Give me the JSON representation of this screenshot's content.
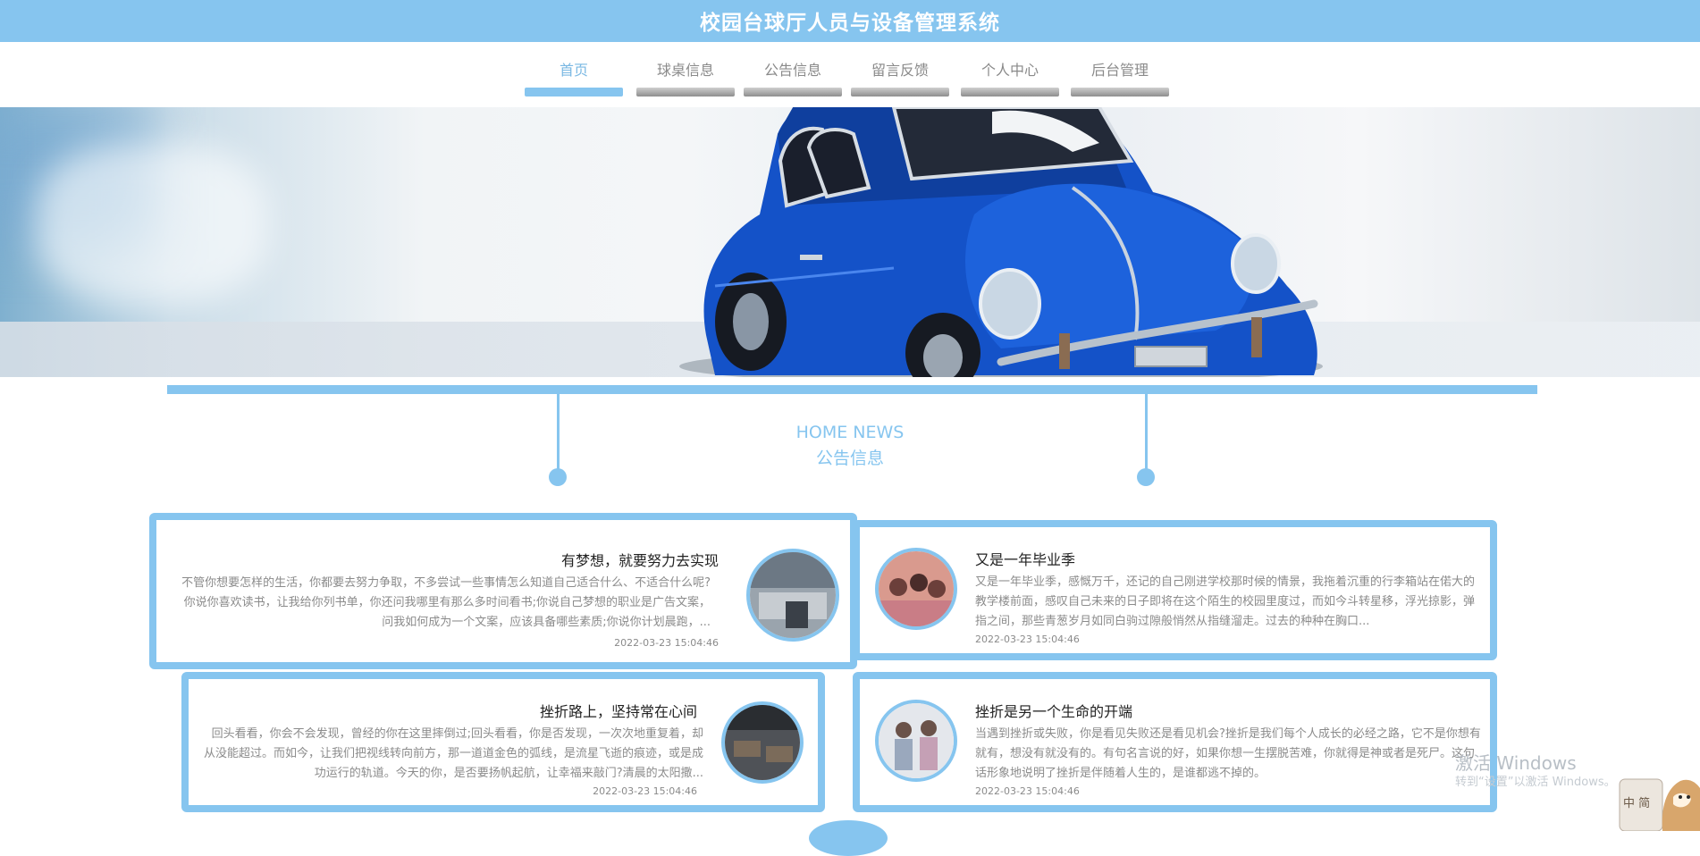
{
  "header": {
    "title": "校园台球厅人员与设备管理系统"
  },
  "nav": {
    "items": [
      {
        "label": "首页",
        "active": true
      },
      {
        "label": "球桌信息",
        "active": false
      },
      {
        "label": "公告信息",
        "active": false
      },
      {
        "label": "留言反馈",
        "active": false
      },
      {
        "label": "个人中心",
        "active": false
      },
      {
        "label": "后台管理",
        "active": false
      }
    ]
  },
  "news": {
    "heading_en": "HOME NEWS",
    "heading_cn": "公告信息",
    "items": [
      {
        "title": "有梦想，就要努力去实现",
        "text": "不管你想要怎样的生活，你都要去努力争取，不多尝试一些事情怎么知道自己适合什么、不适合什么呢?你说你喜欢读书，让我给你列书单，你还问我哪里有那么多时间看书;你说自己梦想的职业是广告文案，问我如何成为一个文案，应该具备哪些素质;你说你计划晨跑，...",
        "time": "2022-03-23 15:04:46"
      },
      {
        "title": "又是一年毕业季",
        "text": "又是一年毕业季，感慨万千，还记的自己刚进学校那时候的情景，我拖着沉重的行李箱站在偌大的教学楼前面，感叹自己未来的日子即将在这个陌生的校园里度过，而如今斗转星移，浮光掠影，弹指之间，那些青葱岁月如同白驹过隙般悄然从指缝溜走。过去的种种在胸口...",
        "time": "2022-03-23 15:04:46"
      },
      {
        "title": "挫折路上，坚持常在心间",
        "text": "回头看看，你会不会发现，曾经的你在这里摔倒过;回头看看，你是否发现，一次次地重复着，却从没能超过。而如今，让我们把视线转向前方，那一道道金色的弧线，是流星飞逝的痕迹，或是成功运行的轨道。今天的你，是否要扬帆起航，让幸福来敲门?清晨的太阳撒...",
        "time": "2022-03-23 15:04:46"
      },
      {
        "title": "挫折是另一个生命的开端",
        "text": "当遇到挫折或失败，你是看见失败还是看见机会?挫折是我们每个人成长的必经之路，它不是你想有就有，想没有就没有的。有句名言说的好，如果你想一生摆脱苦难，你就得是神或者是死尸。这句话形象地说明了挫折是伴随着人生的，是谁都逃不掉的。",
        "time": "2022-03-23 15:04:46"
      }
    ]
  },
  "os_overlay": {
    "line1": "激活 Windows",
    "line2": "转到“设置”以激活 Windows。",
    "ime": "中 简"
  },
  "colors": {
    "accent": "#86c5ef",
    "nav_inactive_bar": "#9a9a9a"
  }
}
